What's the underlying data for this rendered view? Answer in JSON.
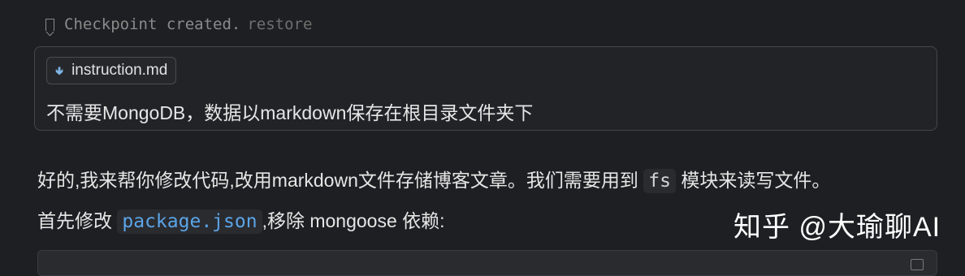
{
  "checkpoint": {
    "text": "Checkpoint created.",
    "restore_label": "restore"
  },
  "user_message": {
    "attachment": {
      "icon": "download-arrow-icon",
      "filename": "instruction.md"
    },
    "text": "不需要MongoDB，数据以markdown保存在根目录文件夹下"
  },
  "response": {
    "line1_before": "好的,我来帮你修改代码,改用markdown文件存储博客文章。我们需要用到 ",
    "line1_code": "fs",
    "line1_after": " 模块来读写文件。",
    "line2_before": "首先修改 ",
    "line2_code": "package.json",
    "line2_after": ",移除 mongoose 依赖:"
  },
  "watermark": "知乎 @大瑜聊AI",
  "colors": {
    "background": "#1e1f22",
    "code_accent": "#5aa5e8",
    "muted_text": "#8a8a8a"
  }
}
